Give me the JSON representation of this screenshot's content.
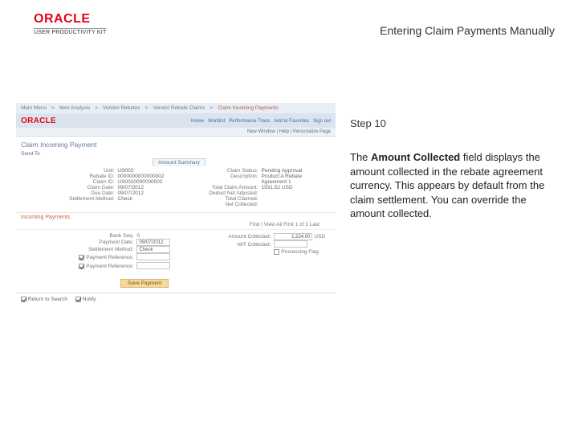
{
  "brand": {
    "name": "ORACLE",
    "product": "USER PRODUCTIVITY KIT"
  },
  "page_title": "Entering Claim Payments Manually",
  "step_label": "Step 10",
  "instruction": {
    "prefix": "The ",
    "bold": "Amount Collected",
    "suffix": " field displays the amount collected in the rebate agreement currency. This appears by default from the claim settlement. You can override the amount collected."
  },
  "ss": {
    "tabs": [
      "Main Menu",
      "Item Analysis",
      "Vendor Rebates",
      "Vendor Rebate Claims",
      "Claim Incoming Payments"
    ],
    "brand_links": [
      "Home",
      "Worklist",
      "Performance Trace",
      "Add to Favorites",
      "Sign out"
    ],
    "underbar": "New Window | Help | Personalize Page",
    "section_title": "Claim Incoming Payment",
    "tab_inner": "Send To",
    "amount_hdr": "Amount Summary",
    "left_fields": [
      {
        "lbl": "Unit:",
        "val": "US002"
      },
      {
        "lbl": "Rebate ID:",
        "val": "0000000000000002"
      },
      {
        "lbl": "Claim ID:",
        "val": "US0020000000002"
      },
      {
        "lbl": "Claim Date:",
        "val": "09/07/2012"
      },
      {
        "lbl": "Due Date:",
        "val": "09/07/2012"
      },
      {
        "lbl": "Settlement Method:",
        "val": "Check"
      }
    ],
    "right_fields": [
      {
        "lbl": "Claim Status:",
        "val": "Pending Approval"
      },
      {
        "lbl": "Description:",
        "val": "Product A Rebate Agreement 1"
      },
      {
        "lbl": "",
        "val": ""
      },
      {
        "lbl": "Total Claim Amount:",
        "val": "1931.52  USD"
      },
      {
        "lbl": "Deduct Net Adjusted:",
        "val": ""
      },
      {
        "lbl": "Total Claimed:",
        "val": ""
      },
      {
        "lbl": "Net Collected:",
        "val": ""
      }
    ],
    "incoming_label": "Incoming Payments",
    "incoming_row": "Find | View All    First  1 of 1  Last",
    "form_left": [
      {
        "lbl": "Bank Seq:",
        "ctl": "0"
      },
      {
        "lbl": "Payment Date:",
        "ctl": "09/07/2012"
      },
      {
        "lbl": "Settlement Method:",
        "ctl": "Check"
      },
      {
        "lbl": "Payment Reference:",
        "ctl": ""
      },
      {
        "lbl": "Payment Reference:",
        "ctl": ""
      }
    ],
    "form_right": [
      {
        "lbl": "Amount Collected:",
        "ctl": "1,224.00",
        "unit": "USD"
      },
      {
        "lbl": "VAT Collected:",
        "ctl": ""
      },
      {
        "lbl": "Processing Flag",
        "chk": false
      }
    ],
    "save_btn": "Save Payment",
    "footer": [
      {
        "chk": true,
        "label": "Return to Search"
      },
      {
        "chk": true,
        "label": "Notify"
      }
    ]
  }
}
